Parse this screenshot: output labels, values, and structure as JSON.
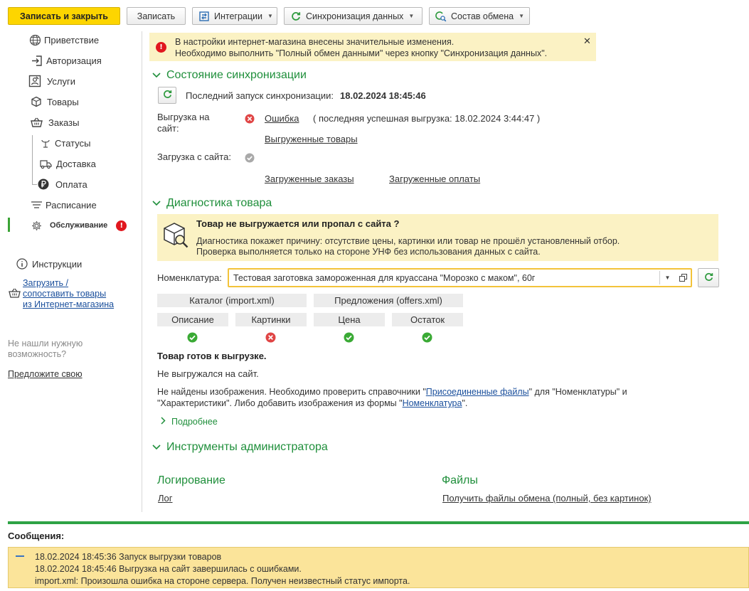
{
  "toolbar": {
    "save_close": "Записать и закрыть",
    "save": "Записать",
    "integrations": "Интеграции",
    "sync": "Синхронизация данных",
    "exchange": "Состав обмена"
  },
  "sidebar": {
    "items": [
      {
        "label": "Приветствие",
        "icon": "globe-icon"
      },
      {
        "label": "Авторизация",
        "icon": "login-icon"
      },
      {
        "label": "Услуги",
        "icon": "services-icon"
      },
      {
        "label": "Товары",
        "icon": "box-icon"
      },
      {
        "label": "Заказы",
        "icon": "basket-icon"
      },
      {
        "label": "Статусы",
        "icon": "status-icon"
      },
      {
        "label": "Доставка",
        "icon": "truck-icon"
      },
      {
        "label": "Оплата",
        "icon": "ruble-icon"
      },
      {
        "label": "Расписание",
        "icon": "schedule-icon"
      },
      {
        "label": "Обслуживание",
        "icon": "gear-icon",
        "badge": "!"
      }
    ],
    "instructions": "Инструкции",
    "upload_link": [
      "Загрузить /",
      "сопоставить товары",
      "из Интернет-магазина"
    ],
    "not_found": [
      "Не нашли нужную",
      "возможность?"
    ],
    "suggest": "Предложите свою"
  },
  "notice": {
    "line1": "В настройки интернет-магазина внесены значительные изменения.",
    "line2": "Необходимо выполнить \"Полный обмен данными\" через кнопку \"Синхронизация данных\"."
  },
  "sync_state": {
    "title": "Состояние синхронизации",
    "last_run_label": "Последний запуск синхронизации:",
    "last_run_value": "18.02.2024 18:45:46",
    "upload_label": [
      "Выгрузка на",
      "сайт:"
    ],
    "upload_status": "Ошибка",
    "upload_last_success": "( последняя успешная выгрузка: 18.02.2024 3:44:47 )",
    "uploaded_goods": "Выгруженные товары",
    "download_label": "Загрузка с сайта:",
    "downloaded_orders": "Загруженные заказы",
    "downloaded_payments": "Загруженные оплаты"
  },
  "diagnostics": {
    "title": "Диагностика товара",
    "question": "Товар не выгружается или пропал с сайта ?",
    "desc1": "Диагностика покажет причину: отсутствие цены, картинки или товар не прошёл установленный отбор.",
    "desc2": "Проверка выполняется только на стороне УНФ без использования данных с сайта.",
    "nom_label": "Номенклатура:",
    "nom_value": "Тестовая заготовка замороженная для круассана \"Морозко с маком\", 60г",
    "catalog": "Каталог (import.xml)",
    "offers": "Предложения (offers.xml)",
    "checks": [
      {
        "label": "Описание",
        "ok": true
      },
      {
        "label": "Картинки",
        "ok": false
      },
      {
        "label": "Цена",
        "ok": true
      },
      {
        "label": "Остаток",
        "ok": true
      }
    ],
    "ready": "Товар готов к выгрузке.",
    "not_uploaded": "Не выгружался на сайт.",
    "img_a": "Не найдены изображения. Необходимо проверить справочники \"",
    "img_link1": "Присоединенные файлы",
    "img_b": "\" для \"Номенклатуры\" и",
    "img_c": "\"Характеристики\". Либо добавить изображения из формы \"",
    "img_link2": "Номенклатура",
    "img_d": "\".",
    "more": "Подробнее"
  },
  "admin": {
    "title": "Инструменты администратора",
    "logging": "Логирование",
    "log": "Лог",
    "files": "Файлы",
    "get_files": "Получить файлы обмена (полный, без картинок)"
  },
  "messages": {
    "title": "Сообщения:",
    "lines": [
      "18.02.2024 18:45:36 Запуск выгрузки товаров",
      "18.02.2024 18:45:46 Выгрузка на сайт завершилась с ошибками.",
      "import.xml: Произошла ошибка на стороне сервера. Получен неизвестный статус импорта."
    ]
  },
  "colors": {
    "accent_green": "#1f8f3b",
    "primary_yellow": "#fdd500",
    "error_red": "#e1171e",
    "notice_bg": "#fbf2c4",
    "link_blue": "#1a4f9c"
  }
}
